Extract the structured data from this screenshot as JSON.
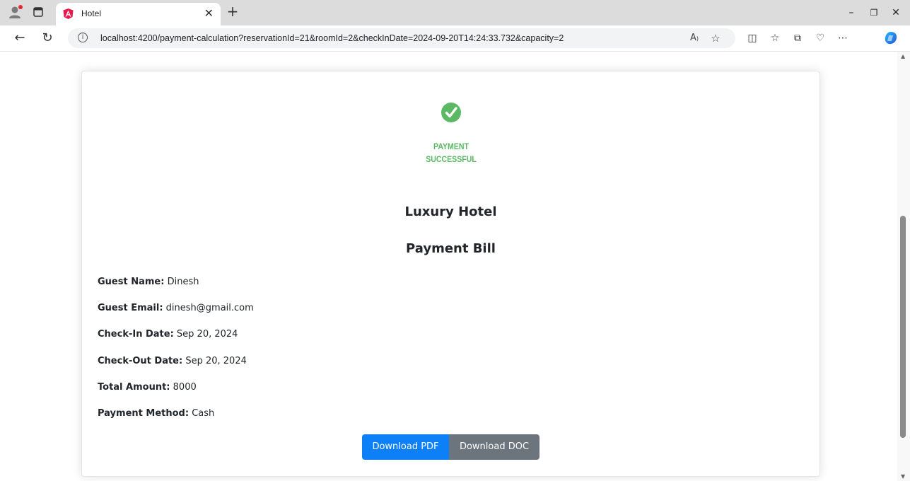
{
  "browser": {
    "tab": {
      "title": "Hotel"
    },
    "address": {
      "url": "localhost:4200/payment-calculation?reservationId=21&roomId=2&checkInDate=2024-09-20T14:24:33.732&capacity=2"
    },
    "icons": {
      "profile": "profile-icon",
      "workspaces": "workspaces-icon",
      "favicon": "angular-favicon",
      "close_tab": "close-icon",
      "new_tab": "plus-icon",
      "minimize": "minimize-icon",
      "restore": "restore-icon",
      "close_window": "close-icon",
      "back": "back-arrow-icon",
      "refresh": "refresh-icon",
      "site_info": "info-icon",
      "read_aloud": "read-aloud-icon",
      "favorite": "star-icon",
      "split_screen": "split-screen-icon",
      "favorites": "favorites-icon",
      "collections": "collections-icon",
      "browser_essentials": "heart-pulse-icon",
      "more": "more-icon",
      "copilot": "copilot-icon"
    }
  },
  "page": {
    "status": {
      "line1": "PAYMENT",
      "line2": "SUCCESSFUL"
    },
    "hotel_name": "Luxury Hotel",
    "bill_title": "Payment Bill",
    "details": [
      {
        "label": "Guest Name:",
        "value": "Dinesh"
      },
      {
        "label": "Guest Email:",
        "value": "dinesh@gmail.com"
      },
      {
        "label": "Check-In Date:",
        "value": "Sep 20, 2024"
      },
      {
        "label": "Check-Out Date:",
        "value": "Sep 20, 2024"
      },
      {
        "label": "Total Amount:",
        "value": "8000"
      },
      {
        "label": "Payment Method:",
        "value": "Cash"
      }
    ],
    "buttons": {
      "pdf": "Download PDF",
      "doc": "Download DOC"
    }
  },
  "colors": {
    "success_green": "#5bb865",
    "primary_button": "#0d7ff7",
    "secondary_button": "#6c757d"
  }
}
